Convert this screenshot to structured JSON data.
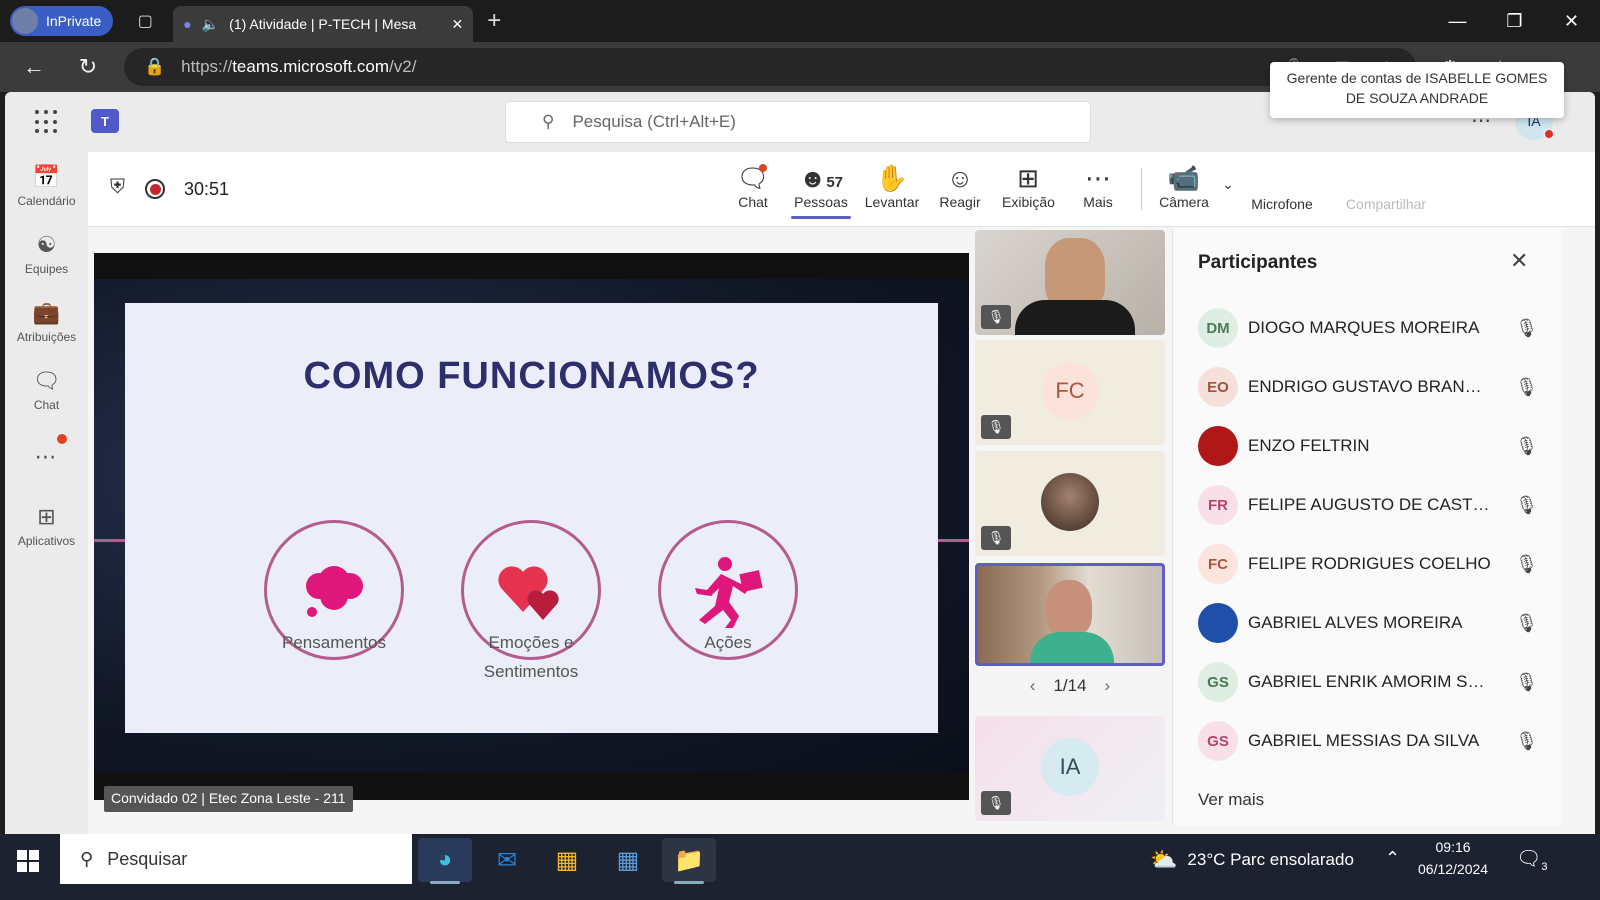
{
  "browser": {
    "inprivate_label": "InPrivate",
    "tab_title": "(1) Atividade | P-TECH | Mesa",
    "url_prefix": "https://",
    "url_domain": "teams.microsoft.com",
    "url_path": "/v2/"
  },
  "teams": {
    "search_placeholder": "Pesquisa (Ctrl+Alt+E)",
    "user_initials": "IA",
    "tooltip": "Gerente de contas de ISABELLE GOMES DE SOUZA ANDRADE",
    "rail": [
      {
        "label": "Calendário",
        "icon": "calendar-icon"
      },
      {
        "label": "Equipes",
        "icon": "teams-icon"
      },
      {
        "label": "Atribuições",
        "icon": "assignments-icon"
      },
      {
        "label": "Chat",
        "icon": "chat-icon"
      },
      {
        "label": "Aplicativos",
        "icon": "apps-icon"
      }
    ]
  },
  "meeting": {
    "timer": "30:51",
    "people_count": "57",
    "controls": {
      "chat": "Chat",
      "people": "Pessoas",
      "raise": "Levantar",
      "react": "Reagir",
      "view": "Exibição",
      "more": "Mais",
      "camera": "Câmera",
      "mic": "Microfone",
      "share": "Compartilhar"
    },
    "slide": {
      "title": "COMO FUNCIONAMOS?",
      "items": [
        "Pensamentos",
        "Emoções e Sentimentos",
        "Ações"
      ],
      "item2_line1": "Emoções e",
      "item2_line2": "Sentimentos"
    },
    "presenter_caption": "Convidado 02 | Etec Zona Leste - 211",
    "tiles": [
      {
        "initials": ""
      },
      {
        "initials": "FC"
      },
      {
        "initials": ""
      },
      {
        "initials": ""
      },
      {
        "initials": "IA"
      }
    ],
    "pager": "1/14"
  },
  "participants": {
    "title": "Participantes",
    "list": [
      {
        "initials": "DM",
        "name": "DIOGO MARQUES MOREIRA",
        "color": "#dfeee2",
        "fg": "#4a7a54"
      },
      {
        "initials": "EO",
        "name": "ENDRIGO GUSTAVO BRANDA...",
        "color": "#f6e0da",
        "fg": "#a4513a"
      },
      {
        "initials": "",
        "name": "ENZO FELTRIN",
        "color": "#b01818",
        "fg": "#fff"
      },
      {
        "initials": "FR",
        "name": "FELIPE AUGUSTO DE CASTRO ...",
        "color": "#f8dfe8",
        "fg": "#b2466c"
      },
      {
        "initials": "FC",
        "name": "FELIPE RODRIGUES COELHO",
        "color": "#fbe5de",
        "fg": "#b0553b"
      },
      {
        "initials": "",
        "name": "GABRIEL ALVES MOREIRA",
        "color": "#1f4fa8",
        "fg": "#fff"
      },
      {
        "initials": "GS",
        "name": "GABRIEL ENRIK AMORIM SOU...",
        "color": "#dfeee2",
        "fg": "#4a7a54"
      },
      {
        "initials": "GS",
        "name": "GABRIEL MESSIAS DA SILVA",
        "color": "#f8dfe8",
        "fg": "#b2466c"
      }
    ],
    "more_label": "Ver mais"
  },
  "taskbar": {
    "search": "Pesquisar",
    "weather": "23°C  Parc ensolarado",
    "time": "09:16",
    "date": "06/12/2024",
    "notifications": "3"
  }
}
